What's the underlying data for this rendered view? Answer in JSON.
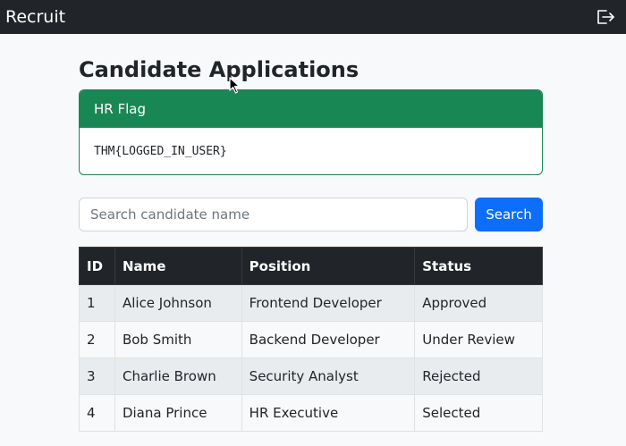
{
  "navbar": {
    "brand": "Recruit",
    "logout_icon": "logout-icon"
  },
  "main": {
    "title": "Candidate Applications",
    "flag_card": {
      "header": "HR Flag",
      "value": "THM{LOGGED_IN_USER}",
      "accent": "#198754"
    },
    "search": {
      "placeholder": "Search candidate name",
      "value": "",
      "button_label": "Search",
      "button_color": "#0d6efd"
    },
    "table": {
      "headers": [
        "ID",
        "Name",
        "Position",
        "Status"
      ],
      "rows": [
        [
          "1",
          "Alice Johnson",
          "Frontend Developer",
          "Approved"
        ],
        [
          "2",
          "Bob Smith",
          "Backend Developer",
          "Under Review"
        ],
        [
          "3",
          "Charlie Brown",
          "Security Analyst",
          "Rejected"
        ],
        [
          "4",
          "Diana Prince",
          "HR Executive",
          "Selected"
        ]
      ]
    }
  }
}
